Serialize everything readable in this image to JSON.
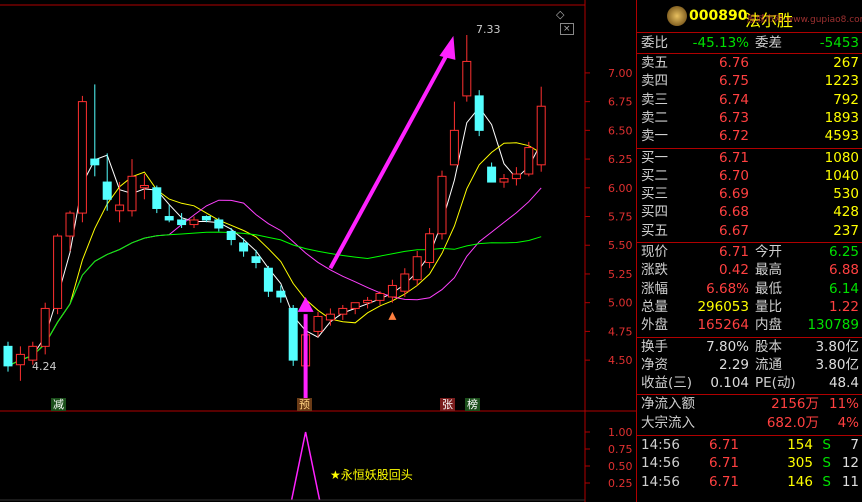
{
  "header": {
    "code": "000890",
    "name": "法尔胜",
    "watermark": "股城市网 www.gupiao8.com"
  },
  "price_axis": {
    "ticks": [
      "7.00",
      "6.75",
      "6.50",
      "6.25",
      "6.00",
      "5.75",
      "5.50",
      "5.25",
      "5.00",
      "4.75",
      "4.50"
    ],
    "indicator_ticks": [
      "1.00",
      "0.75",
      "0.50",
      "0.25"
    ]
  },
  "annotations": {
    "high": "7.33",
    "low": "4.24",
    "badge_jian": "减",
    "badge_yu": "预",
    "badge_zhang": "张",
    "badge_bang": "榜",
    "signal_label": "永恒妖股回头",
    "signal_star": "★"
  },
  "chart_data": {
    "type": "candlestick",
    "ylim": [
      4.24,
      7.33
    ],
    "candles": [
      {
        "o": 4.62,
        "h": 4.66,
        "l": 4.4,
        "c": 4.45
      },
      {
        "o": 4.46,
        "h": 4.62,
        "l": 4.32,
        "c": 4.55
      },
      {
        "o": 4.5,
        "h": 4.66,
        "l": 4.46,
        "c": 4.62
      },
      {
        "o": 4.62,
        "h": 5.0,
        "l": 4.55,
        "c": 4.95
      },
      {
        "o": 4.95,
        "h": 5.6,
        "l": 4.9,
        "c": 5.58
      },
      {
        "o": 5.58,
        "h": 5.8,
        "l": 5.45,
        "c": 5.78
      },
      {
        "o": 5.78,
        "h": 6.8,
        "l": 5.7,
        "c": 6.75
      },
      {
        "o": 6.25,
        "h": 6.9,
        "l": 6.1,
        "c": 6.2
      },
      {
        "o": 6.05,
        "h": 6.3,
        "l": 5.8,
        "c": 5.9
      },
      {
        "o": 5.8,
        "h": 6.05,
        "l": 5.7,
        "c": 5.85
      },
      {
        "o": 5.8,
        "h": 6.25,
        "l": 5.75,
        "c": 6.1
      },
      {
        "o": 6.0,
        "h": 6.12,
        "l": 5.9,
        "c": 6.02
      },
      {
        "o": 6.0,
        "h": 6.02,
        "l": 5.78,
        "c": 5.82
      },
      {
        "o": 5.75,
        "h": 5.85,
        "l": 5.7,
        "c": 5.72
      },
      {
        "o": 5.72,
        "h": 5.78,
        "l": 5.65,
        "c": 5.68
      },
      {
        "o": 5.68,
        "h": 5.75,
        "l": 5.65,
        "c": 5.72
      },
      {
        "o": 5.75,
        "h": 5.76,
        "l": 5.7,
        "c": 5.72
      },
      {
        "o": 5.72,
        "h": 5.74,
        "l": 5.62,
        "c": 5.65
      },
      {
        "o": 5.62,
        "h": 5.65,
        "l": 5.5,
        "c": 5.55
      },
      {
        "o": 5.52,
        "h": 5.56,
        "l": 5.4,
        "c": 5.45
      },
      {
        "o": 5.4,
        "h": 5.46,
        "l": 5.3,
        "c": 5.35
      },
      {
        "o": 5.3,
        "h": 5.32,
        "l": 5.05,
        "c": 5.1
      },
      {
        "o": 5.1,
        "h": 5.15,
        "l": 5.0,
        "c": 5.05
      },
      {
        "o": 4.95,
        "h": 4.98,
        "l": 4.45,
        "c": 4.5
      },
      {
        "o": 4.45,
        "h": 4.75,
        "l": 4.3,
        "c": 4.72
      },
      {
        "o": 4.75,
        "h": 4.92,
        "l": 4.7,
        "c": 4.88
      },
      {
        "o": 4.85,
        "h": 4.95,
        "l": 4.8,
        "c": 4.9
      },
      {
        "o": 4.9,
        "h": 4.98,
        "l": 4.85,
        "c": 4.95
      },
      {
        "o": 4.95,
        "h": 5.0,
        "l": 4.9,
        "c": 5.0
      },
      {
        "o": 5.0,
        "h": 5.05,
        "l": 4.95,
        "c": 5.02
      },
      {
        "o": 5.02,
        "h": 5.1,
        "l": 4.98,
        "c": 5.08
      },
      {
        "o": 5.05,
        "h": 5.2,
        "l": 5.0,
        "c": 5.15
      },
      {
        "o": 5.1,
        "h": 5.3,
        "l": 5.05,
        "c": 5.25
      },
      {
        "o": 5.2,
        "h": 5.45,
        "l": 5.15,
        "c": 5.4
      },
      {
        "o": 5.35,
        "h": 5.65,
        "l": 5.3,
        "c": 5.6
      },
      {
        "o": 5.6,
        "h": 6.15,
        "l": 5.55,
        "c": 6.1
      },
      {
        "o": 6.2,
        "h": 6.75,
        "l": 6.2,
        "c": 6.5
      },
      {
        "o": 6.8,
        "h": 7.33,
        "l": 6.75,
        "c": 7.1
      },
      {
        "o": 6.8,
        "h": 6.85,
        "l": 6.45,
        "c": 6.5
      },
      {
        "o": 6.18,
        "h": 6.22,
        "l": 6.05,
        "c": 6.05
      },
      {
        "o": 6.05,
        "h": 6.12,
        "l": 6.0,
        "c": 6.08
      },
      {
        "o": 6.08,
        "h": 6.18,
        "l": 6.02,
        "c": 6.12
      },
      {
        "o": 6.12,
        "h": 6.4,
        "l": 6.1,
        "c": 6.35
      },
      {
        "o": 6.2,
        "h": 6.88,
        "l": 6.14,
        "c": 6.71
      }
    ],
    "indicator": {
      "ylim": [
        0,
        1.0
      ],
      "spike_index": 24,
      "spike_value": 1.0
    }
  },
  "quote": {
    "weibi_label": "委比",
    "weibi_value": "-45.13%",
    "weicha_label": "委差",
    "weicha_value": "-5453",
    "asks": [
      {
        "label": "卖五",
        "price": "6.76",
        "vol": "267"
      },
      {
        "label": "卖四",
        "price": "6.75",
        "vol": "1223"
      },
      {
        "label": "卖三",
        "price": "6.74",
        "vol": "792"
      },
      {
        "label": "卖二",
        "price": "6.73",
        "vol": "1893"
      },
      {
        "label": "卖一",
        "price": "6.72",
        "vol": "4593"
      }
    ],
    "bids": [
      {
        "label": "买一",
        "price": "6.71",
        "vol": "1080"
      },
      {
        "label": "买二",
        "price": "6.70",
        "vol": "1040"
      },
      {
        "label": "买三",
        "price": "6.69",
        "vol": "530"
      },
      {
        "label": "买四",
        "price": "6.68",
        "vol": "428"
      },
      {
        "label": "买五",
        "price": "6.67",
        "vol": "237"
      }
    ],
    "stats": [
      {
        "l1": "现价",
        "v1": "6.71",
        "c1": "red",
        "l2": "今开",
        "v2": "6.25",
        "c2": "green"
      },
      {
        "l1": "涨跌",
        "v1": "0.42",
        "c1": "red",
        "l2": "最高",
        "v2": "6.88",
        "c2": "red"
      },
      {
        "l1": "涨幅",
        "v1": "6.68%",
        "c1": "red",
        "l2": "最低",
        "v2": "6.14",
        "c2": "green"
      },
      {
        "l1": "总量",
        "v1": "296053",
        "c1": "yellow",
        "l2": "量比",
        "v2": "1.22",
        "c2": "red"
      },
      {
        "l1": "外盘",
        "v1": "165264",
        "c1": "red",
        "l2": "内盘",
        "v2": "130789",
        "c2": "green"
      }
    ],
    "fund": [
      {
        "l1": "换手",
        "v1": "7.80%",
        "l2": "股本",
        "v2": "3.80亿"
      },
      {
        "l1": "净资",
        "v1": "2.29",
        "l2": "流通",
        "v2": "3.80亿"
      },
      {
        "l1": "收益(三)",
        "v1": "0.104",
        "l2": "PE(动)",
        "v2": "48.4"
      }
    ],
    "flow": [
      {
        "label": "净流入额",
        "value": "2156万",
        "pct": "11%"
      },
      {
        "label": "大宗流入",
        "value": "682.0万",
        "pct": "4%"
      }
    ],
    "ticks": [
      {
        "time": "14:56",
        "price": "6.71",
        "vol": "154",
        "side": "S",
        "n": "7"
      },
      {
        "time": "14:56",
        "price": "6.71",
        "vol": "305",
        "side": "S",
        "n": "12"
      },
      {
        "time": "14:56",
        "price": "6.71",
        "vol": "146",
        "side": "S",
        "n": "11"
      }
    ]
  },
  "colors": {
    "up": "#ff3030",
    "down": "#54ffff",
    "ma5": "#ffffff",
    "ma10": "#ffff00",
    "ma20": "#ff40ff",
    "ma60": "#00ff00",
    "arrow": "#ff22ff",
    "grid": "#b00000"
  }
}
